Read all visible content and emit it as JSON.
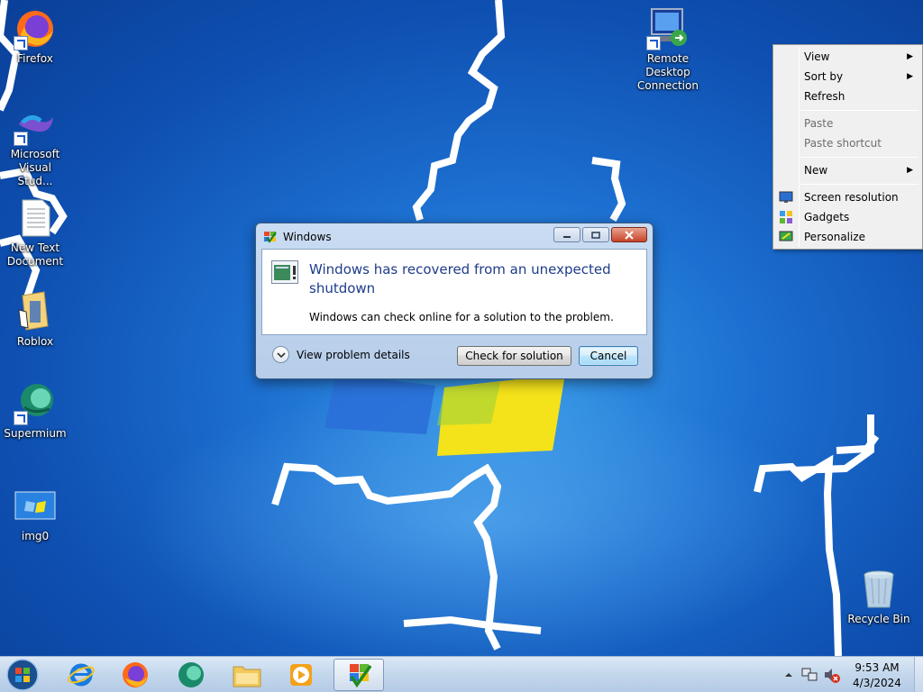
{
  "desktop": {
    "icons": [
      {
        "label": "Firefox"
      },
      {
        "label": "Microsoft Visual Stud..."
      },
      {
        "label": "New Text Document"
      },
      {
        "label": "Roblox"
      },
      {
        "label": "Supermium"
      },
      {
        "label": "img0"
      },
      {
        "label": "Remote Desktop Connection"
      },
      {
        "label": "Recycle Bin"
      }
    ]
  },
  "dialog": {
    "title": "Windows",
    "heading": "Windows has recovered from an unexpected shutdown",
    "message": "Windows can check online for a solution to the problem.",
    "details_label": "View problem details",
    "check_button": "Check for solution",
    "cancel_button": "Cancel"
  },
  "context_menu": {
    "items": [
      {
        "label": "View",
        "submenu": true
      },
      {
        "label": "Sort by",
        "submenu": true
      },
      {
        "label": "Refresh"
      },
      {
        "label": "Paste",
        "disabled": true
      },
      {
        "label": "Paste shortcut",
        "disabled": true
      },
      {
        "label": "New",
        "submenu": true
      },
      {
        "label": "Screen resolution"
      },
      {
        "label": "Gadgets"
      },
      {
        "label": "Personalize"
      }
    ]
  },
  "taskbar": {
    "pinned": [
      "internet-explorer",
      "firefox",
      "supermium",
      "file-explorer",
      "media-player",
      "action-center-app"
    ],
    "clock_time": "9:53 AM",
    "clock_date": "4/3/2024"
  },
  "colors": {
    "dialog_heading": "#1e3c8a",
    "desktop_bg": "#1c6fd0"
  }
}
